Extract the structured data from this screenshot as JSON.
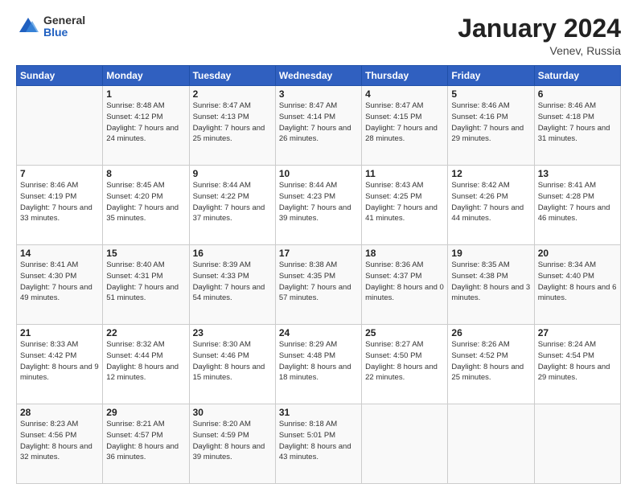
{
  "logo": {
    "general": "General",
    "blue": "Blue"
  },
  "title": "January 2024",
  "location": "Venev, Russia",
  "header": {
    "days": [
      "Sunday",
      "Monday",
      "Tuesday",
      "Wednesday",
      "Thursday",
      "Friday",
      "Saturday"
    ]
  },
  "weeks": [
    [
      {
        "day": "",
        "sunrise": "",
        "sunset": "",
        "daylight": ""
      },
      {
        "day": "1",
        "sunrise": "Sunrise: 8:48 AM",
        "sunset": "Sunset: 4:12 PM",
        "daylight": "Daylight: 7 hours and 24 minutes."
      },
      {
        "day": "2",
        "sunrise": "Sunrise: 8:47 AM",
        "sunset": "Sunset: 4:13 PM",
        "daylight": "Daylight: 7 hours and 25 minutes."
      },
      {
        "day": "3",
        "sunrise": "Sunrise: 8:47 AM",
        "sunset": "Sunset: 4:14 PM",
        "daylight": "Daylight: 7 hours and 26 minutes."
      },
      {
        "day": "4",
        "sunrise": "Sunrise: 8:47 AM",
        "sunset": "Sunset: 4:15 PM",
        "daylight": "Daylight: 7 hours and 28 minutes."
      },
      {
        "day": "5",
        "sunrise": "Sunrise: 8:46 AM",
        "sunset": "Sunset: 4:16 PM",
        "daylight": "Daylight: 7 hours and 29 minutes."
      },
      {
        "day": "6",
        "sunrise": "Sunrise: 8:46 AM",
        "sunset": "Sunset: 4:18 PM",
        "daylight": "Daylight: 7 hours and 31 minutes."
      }
    ],
    [
      {
        "day": "7",
        "sunrise": "Sunrise: 8:46 AM",
        "sunset": "Sunset: 4:19 PM",
        "daylight": "Daylight: 7 hours and 33 minutes."
      },
      {
        "day": "8",
        "sunrise": "Sunrise: 8:45 AM",
        "sunset": "Sunset: 4:20 PM",
        "daylight": "Daylight: 7 hours and 35 minutes."
      },
      {
        "day": "9",
        "sunrise": "Sunrise: 8:44 AM",
        "sunset": "Sunset: 4:22 PM",
        "daylight": "Daylight: 7 hours and 37 minutes."
      },
      {
        "day": "10",
        "sunrise": "Sunrise: 8:44 AM",
        "sunset": "Sunset: 4:23 PM",
        "daylight": "Daylight: 7 hours and 39 minutes."
      },
      {
        "day": "11",
        "sunrise": "Sunrise: 8:43 AM",
        "sunset": "Sunset: 4:25 PM",
        "daylight": "Daylight: 7 hours and 41 minutes."
      },
      {
        "day": "12",
        "sunrise": "Sunrise: 8:42 AM",
        "sunset": "Sunset: 4:26 PM",
        "daylight": "Daylight: 7 hours and 44 minutes."
      },
      {
        "day": "13",
        "sunrise": "Sunrise: 8:41 AM",
        "sunset": "Sunset: 4:28 PM",
        "daylight": "Daylight: 7 hours and 46 minutes."
      }
    ],
    [
      {
        "day": "14",
        "sunrise": "Sunrise: 8:41 AM",
        "sunset": "Sunset: 4:30 PM",
        "daylight": "Daylight: 7 hours and 49 minutes."
      },
      {
        "day": "15",
        "sunrise": "Sunrise: 8:40 AM",
        "sunset": "Sunset: 4:31 PM",
        "daylight": "Daylight: 7 hours and 51 minutes."
      },
      {
        "day": "16",
        "sunrise": "Sunrise: 8:39 AM",
        "sunset": "Sunset: 4:33 PM",
        "daylight": "Daylight: 7 hours and 54 minutes."
      },
      {
        "day": "17",
        "sunrise": "Sunrise: 8:38 AM",
        "sunset": "Sunset: 4:35 PM",
        "daylight": "Daylight: 7 hours and 57 minutes."
      },
      {
        "day": "18",
        "sunrise": "Sunrise: 8:36 AM",
        "sunset": "Sunset: 4:37 PM",
        "daylight": "Daylight: 8 hours and 0 minutes."
      },
      {
        "day": "19",
        "sunrise": "Sunrise: 8:35 AM",
        "sunset": "Sunset: 4:38 PM",
        "daylight": "Daylight: 8 hours and 3 minutes."
      },
      {
        "day": "20",
        "sunrise": "Sunrise: 8:34 AM",
        "sunset": "Sunset: 4:40 PM",
        "daylight": "Daylight: 8 hours and 6 minutes."
      }
    ],
    [
      {
        "day": "21",
        "sunrise": "Sunrise: 8:33 AM",
        "sunset": "Sunset: 4:42 PM",
        "daylight": "Daylight: 8 hours and 9 minutes."
      },
      {
        "day": "22",
        "sunrise": "Sunrise: 8:32 AM",
        "sunset": "Sunset: 4:44 PM",
        "daylight": "Daylight: 8 hours and 12 minutes."
      },
      {
        "day": "23",
        "sunrise": "Sunrise: 8:30 AM",
        "sunset": "Sunset: 4:46 PM",
        "daylight": "Daylight: 8 hours and 15 minutes."
      },
      {
        "day": "24",
        "sunrise": "Sunrise: 8:29 AM",
        "sunset": "Sunset: 4:48 PM",
        "daylight": "Daylight: 8 hours and 18 minutes."
      },
      {
        "day": "25",
        "sunrise": "Sunrise: 8:27 AM",
        "sunset": "Sunset: 4:50 PM",
        "daylight": "Daylight: 8 hours and 22 minutes."
      },
      {
        "day": "26",
        "sunrise": "Sunrise: 8:26 AM",
        "sunset": "Sunset: 4:52 PM",
        "daylight": "Daylight: 8 hours and 25 minutes."
      },
      {
        "day": "27",
        "sunrise": "Sunrise: 8:24 AM",
        "sunset": "Sunset: 4:54 PM",
        "daylight": "Daylight: 8 hours and 29 minutes."
      }
    ],
    [
      {
        "day": "28",
        "sunrise": "Sunrise: 8:23 AM",
        "sunset": "Sunset: 4:56 PM",
        "daylight": "Daylight: 8 hours and 32 minutes."
      },
      {
        "day": "29",
        "sunrise": "Sunrise: 8:21 AM",
        "sunset": "Sunset: 4:57 PM",
        "daylight": "Daylight: 8 hours and 36 minutes."
      },
      {
        "day": "30",
        "sunrise": "Sunrise: 8:20 AM",
        "sunset": "Sunset: 4:59 PM",
        "daylight": "Daylight: 8 hours and 39 minutes."
      },
      {
        "day": "31",
        "sunrise": "Sunrise: 8:18 AM",
        "sunset": "Sunset: 5:01 PM",
        "daylight": "Daylight: 8 hours and 43 minutes."
      },
      {
        "day": "",
        "sunrise": "",
        "sunset": "",
        "daylight": ""
      },
      {
        "day": "",
        "sunrise": "",
        "sunset": "",
        "daylight": ""
      },
      {
        "day": "",
        "sunrise": "",
        "sunset": "",
        "daylight": ""
      }
    ]
  ]
}
